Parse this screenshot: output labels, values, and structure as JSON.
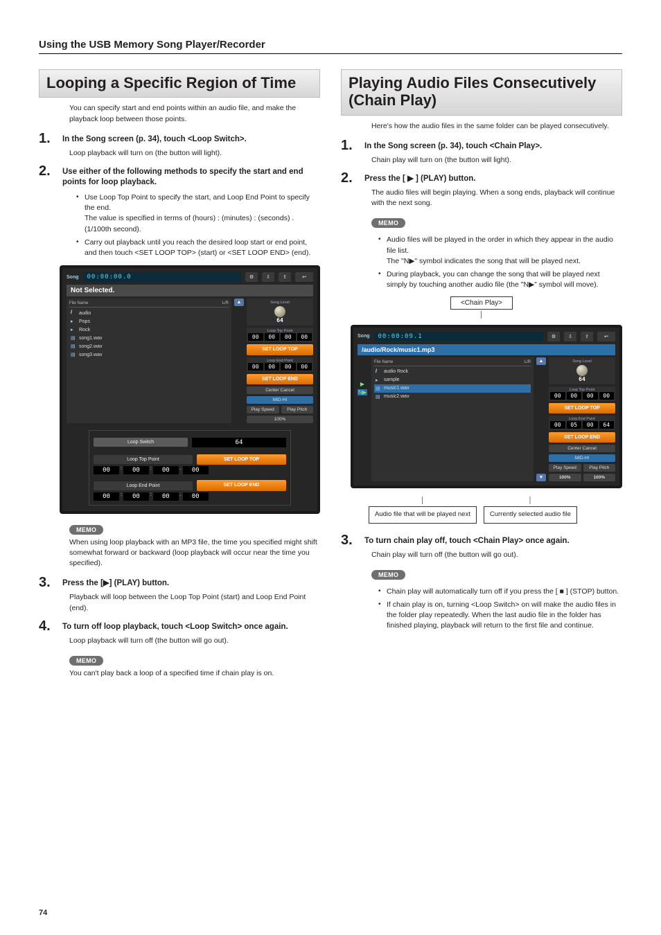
{
  "page": {
    "header": "Using the USB Memory Song Player/Recorder",
    "number": "74"
  },
  "memo_label": "MEMO",
  "left": {
    "title": "Looping a Specific Region of Time",
    "intro": "You can specify start and end points within an audio file, and make the playback loop between those points.",
    "steps": [
      {
        "title": "In the Song screen (p. 34), touch <Loop Switch>.",
        "sub": "Loop playback will turn on (the button will light)."
      },
      {
        "title": "Use either of the following methods to specify the start and end points for loop playback."
      },
      {
        "title": "Press the [▶] (PLAY) button.",
        "sub": "Playback will loop between the Loop Top Point (start) and Loop End Point (end)."
      },
      {
        "title": "To turn off loop playback, touch <Loop Switch> once again.",
        "sub": "Loop playback will turn off (the button will go out)."
      }
    ],
    "step2_bullets": [
      "Use Loop Top Point to specify the start, and Loop End Point to specify the end.\nThe value is specified in terms of (hours) : (minutes) : (seconds) . (1/100th second).",
      "Carry out playback until you reach the desired loop start or end point, and then touch <SET LOOP TOP> (start) or <SET LOOP END> (end)."
    ],
    "memo1": "When using loop playback with an MP3 file, the time you specified might shift somewhat forward or backward (loop playback will occur near the time you specified).",
    "memo2": "You can't play back a loop of a specified time if chain play is on.",
    "shot": {
      "tab": "Song",
      "time": "00:00:00.0",
      "title": "Not Selected.",
      "columns": {
        "name": "File Name",
        "lr": "L/R"
      },
      "items": [
        "audio",
        "Pops",
        "Rock",
        "song1.wav",
        "song2.wav",
        "song3.wav"
      ],
      "panels": {
        "song_level_lbl": "Song Level",
        "song_level": "64",
        "loop_top_lbl": "Loop Top Point",
        "loop_end_lbl": "Loop End Point",
        "set_loop_top": "SET LOOP TOP",
        "set_loop_end": "SET LOOP END",
        "center_cancel": "Center Cancel",
        "mid_hi": "MID-HI",
        "play_speed": "Play Speed",
        "play_pitch": "Play Pitch",
        "p100": "100%"
      },
      "pop": {
        "loop_switch": "Loop Switch",
        "loop_top": "Loop Top Point",
        "loop_end": "Loop End Point",
        "val": "64",
        "segs": [
          "00",
          "00",
          "00",
          "00"
        ]
      }
    }
  },
  "right": {
    "title": "Playing Audio Files Consecutively (Chain Play)",
    "intro": "Here's how the audio files in the same folder can be played consecutively.",
    "steps": [
      {
        "title": "In the Song screen (p. 34), touch <Chain Play>.",
        "sub": "Chain play will turn on (the button will light)."
      },
      {
        "title": "Press the [ ▶ ] (PLAY) button.",
        "sub": "The audio files will begin playing. When a song ends, playback will continue with the next song."
      },
      {
        "title": "To turn chain play off, touch <Chain Play> once again.",
        "sub": "Chain play will turn off (the button will go out)."
      }
    ],
    "memo1_bullets": [
      "Audio files will be played in the order in which they appear in the audio file list.\nThe \"N▶\" symbol indicates the song that will be played next.",
      "During playback, you can change the song that will be played next simply by touching another audio file (the \"N▶\" symbol will move)."
    ],
    "memo2_bullets": [
      "Chain play will automatically turn off if you press the [ ■ ] (STOP) button.",
      "If chain play is on, turning <Loop Switch> on will make the audio files in the folder play repeatedly. When the last audio file in the folder has finished playing, playback will return to the first file and continue."
    ],
    "chain_label": "<Chain Play>",
    "callouts": {
      "next": "Audio file that will be played next",
      "current": "Currently selected audio file"
    },
    "shot": {
      "tab": "Song",
      "time": "00:00:09.1",
      "path": "/audio/Rock/music1.mp3",
      "columns": {
        "name": "File Name",
        "lr": "L/R"
      },
      "items": [
        "audio  Rock",
        "sample",
        "music1.wav",
        "music2.wav"
      ],
      "panels": {
        "song_level_lbl": "Song Level",
        "song_level": "64",
        "loop_top_lbl": "Loop Top Point",
        "loop_end_lbl": "Loop End Point",
        "set_loop_top": "SET LOOP TOP",
        "set_loop_end": "SET LOOP END",
        "center_cancel": "Center Cancel",
        "mid_hi": "MID-HI",
        "play_speed": "Play Speed",
        "play_pitch": "Play Pitch",
        "p100": "100%"
      },
      "top_segs": [
        "00",
        "00",
        "00",
        "00"
      ],
      "end_segs": [
        "00",
        "05",
        "00",
        "64"
      ]
    }
  }
}
